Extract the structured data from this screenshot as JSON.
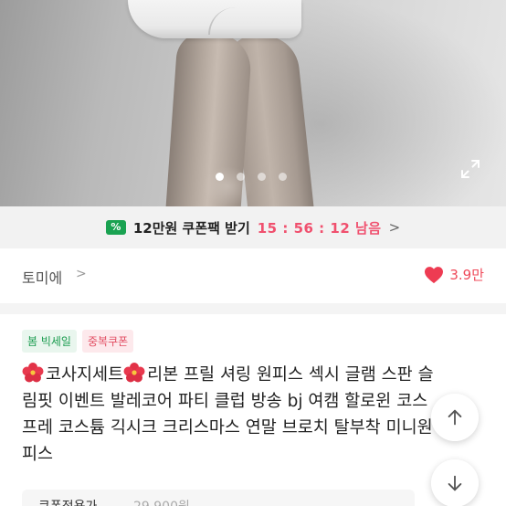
{
  "hero": {
    "dots_total": 4,
    "dots_active_index": 0
  },
  "coupon_bar": {
    "icon_symbol": "%",
    "text": "12만원 쿠폰팩 받기",
    "timer": "15 : 56 : 12 남음",
    "chevron": ">"
  },
  "shop": {
    "name": "토미에",
    "chevron": ">",
    "like_count": "3.9만"
  },
  "tags": [
    "봄 빅세일",
    "중복쿠폰"
  ],
  "title": {
    "part1": "코사지세트",
    "part2": "리본 프릴 셔링 원피스 섹시 글램 스판 슬림핏 이벤트 발레코어 파티 클럽 방송 bj 여캠 할로윈 코스프레 코스튬 긱시크 크리스마스 연말 브로치 탈부착 미니원피스"
  },
  "bottom": {
    "label": "쿠폰적용가",
    "price": "29,900원"
  },
  "colors": {
    "accent_green": "#1aa251",
    "accent_red": "#ef4a5a",
    "timer_pink": "#f0506e"
  }
}
